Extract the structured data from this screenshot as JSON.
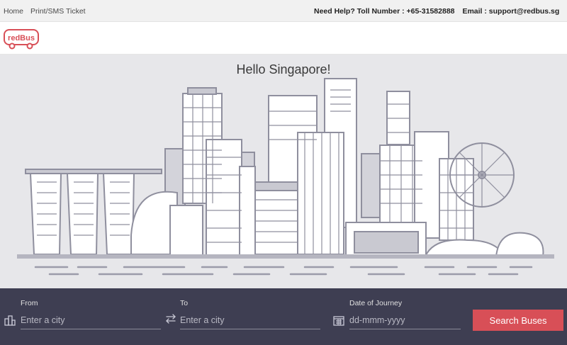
{
  "topbar": {
    "home_label": "Home",
    "print_label": "Print/SMS Ticket",
    "help_text": "Need Help? Toll Number : +65-31582888",
    "email_text": "Email : support@redbus.sg"
  },
  "logo": {
    "text": "redBus",
    "color": "#d84f57"
  },
  "hero": {
    "title": "Hello Singapore!"
  },
  "search": {
    "from_label": "From",
    "from_placeholder": "Enter a city",
    "to_label": "To",
    "to_placeholder": "Enter a city",
    "date_label": "Date of Journey",
    "date_placeholder": "dd-mmm-yyyy",
    "button_label": "Search Buses",
    "button_color": "#d84f57"
  },
  "colors": {
    "search_bar_bg": "#3e3e52",
    "hero_bg": "#e7e7ea",
    "skyline_fill": "#c9c9d1",
    "skyline_stroke": "#8f8f9e"
  }
}
